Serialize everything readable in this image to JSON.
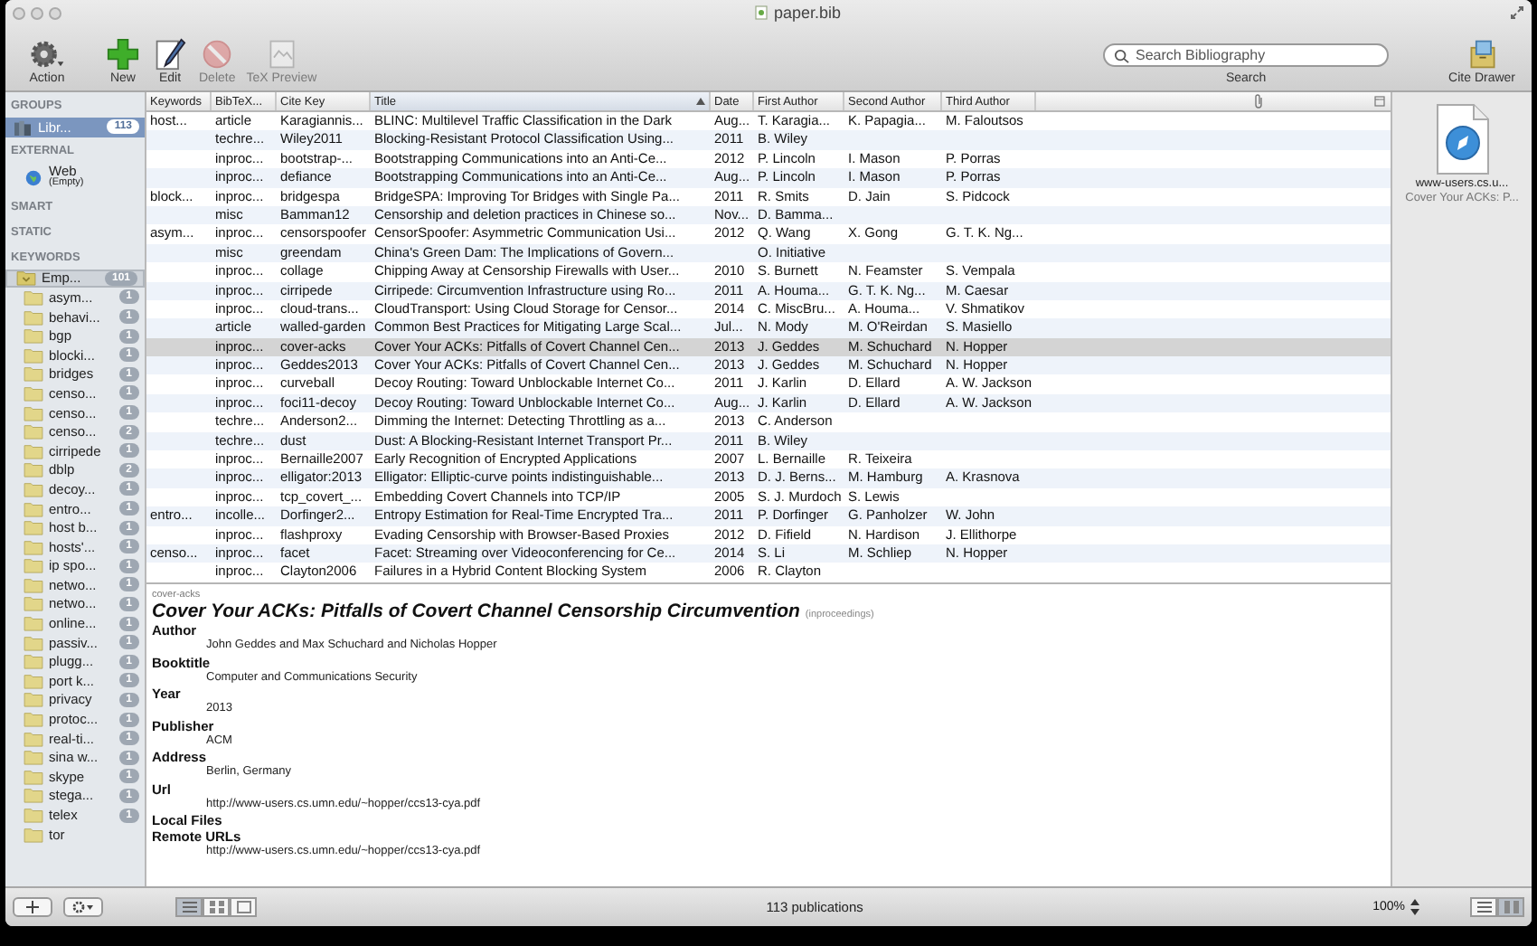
{
  "window": {
    "title": "paper.bib"
  },
  "toolbar": {
    "items": [
      {
        "kind": "action",
        "label": "Action",
        "disabled": false
      },
      {
        "kind": "new",
        "label": "New",
        "disabled": false
      },
      {
        "kind": "edit",
        "label": "Edit",
        "disabled": false
      },
      {
        "kind": "delete",
        "label": "Delete",
        "disabled": true
      },
      {
        "kind": "tex_preview",
        "label": "TeX Preview",
        "disabled": true
      }
    ],
    "search": {
      "placeholder": "Search Bibliography",
      "label": "Search"
    },
    "cite_drawer": {
      "label": "Cite Drawer"
    }
  },
  "sidebar": {
    "sections": [
      {
        "heading": "GROUPS",
        "items": [
          {
            "kind": "library",
            "label": "Libr...",
            "count": "113",
            "selected": true
          }
        ]
      },
      {
        "heading": "EXTERNAL",
        "items": [
          {
            "kind": "web",
            "label": "Web",
            "sublabel": "(Empty)",
            "selected": false
          }
        ]
      },
      {
        "heading": "SMART"
      },
      {
        "heading": "STATIC"
      },
      {
        "heading": "KEYWORDS",
        "items": [
          {
            "kind": "empty",
            "label": "Emp...",
            "count": "101",
            "selected": true
          },
          {
            "kind": "keyword",
            "label": "asym...",
            "count": "1",
            "selected": false
          },
          {
            "kind": "keyword",
            "label": "behavi...",
            "count": "1",
            "selected": false
          },
          {
            "kind": "keyword",
            "label": "bgp",
            "count": "1",
            "selected": false
          },
          {
            "kind": "keyword",
            "label": "blocki...",
            "count": "1",
            "selected": false
          },
          {
            "kind": "keyword",
            "label": "bridges",
            "count": "1",
            "selected": false
          },
          {
            "kind": "keyword",
            "label": "censo...",
            "count": "1",
            "selected": false
          },
          {
            "kind": "keyword",
            "label": "censo...",
            "count": "1",
            "selected": false
          },
          {
            "kind": "keyword",
            "label": "censo...",
            "count": "2",
            "selected": false
          },
          {
            "kind": "keyword",
            "label": "cirripede",
            "count": "1",
            "selected": false
          },
          {
            "kind": "keyword",
            "label": "dblp",
            "count": "2",
            "selected": false
          },
          {
            "kind": "keyword",
            "label": "decoy...",
            "count": "1",
            "selected": false
          },
          {
            "kind": "keyword",
            "label": "entro...",
            "count": "1",
            "selected": false
          },
          {
            "kind": "keyword",
            "label": "host b...",
            "count": "1",
            "selected": false
          },
          {
            "kind": "keyword",
            "label": "hosts'...",
            "count": "1",
            "selected": false
          },
          {
            "kind": "keyword",
            "label": "ip spo...",
            "count": "1",
            "selected": false
          },
          {
            "kind": "keyword",
            "label": "netwo...",
            "count": "1",
            "selected": false
          },
          {
            "kind": "keyword",
            "label": "netwo...",
            "count": "1",
            "selected": false
          },
          {
            "kind": "keyword",
            "label": "online...",
            "count": "1",
            "selected": false
          },
          {
            "kind": "keyword",
            "label": "passiv...",
            "count": "1",
            "selected": false
          },
          {
            "kind": "keyword",
            "label": "plugg...",
            "count": "1",
            "selected": false
          },
          {
            "kind": "keyword",
            "label": "port k...",
            "count": "1",
            "selected": false
          },
          {
            "kind": "keyword",
            "label": "privacy",
            "count": "1",
            "selected": false
          },
          {
            "kind": "keyword",
            "label": "protoc...",
            "count": "1",
            "selected": false
          },
          {
            "kind": "keyword",
            "label": "real-ti...",
            "count": "1",
            "selected": false
          },
          {
            "kind": "keyword",
            "label": "sina w...",
            "count": "1",
            "selected": false
          },
          {
            "kind": "keyword",
            "label": "skype",
            "count": "1",
            "selected": false
          },
          {
            "kind": "keyword",
            "label": "stega...",
            "count": "1",
            "selected": false
          },
          {
            "kind": "keyword",
            "label": "telex",
            "count": "1",
            "selected": false
          },
          {
            "kind": "keyword",
            "label": "tor",
            "selected": false
          }
        ]
      }
    ]
  },
  "table": {
    "columns": [
      {
        "label": "Keywords",
        "sorted": false
      },
      {
        "label": "BibTeX...",
        "sorted": false
      },
      {
        "label": "Cite Key",
        "sorted": false
      },
      {
        "label": "Title",
        "sorted": true
      },
      {
        "label": "Date",
        "sorted": false
      },
      {
        "label": "First Author",
        "sorted": false
      },
      {
        "label": "Second Author",
        "sorted": false
      },
      {
        "label": "Third Author",
        "sorted": false
      }
    ],
    "rows": [
      {
        "selected": false,
        "keywords": "host...",
        "type": "article",
        "cite_key": "Karagiannis...",
        "title": "BLINC: Multilevel Traffic Classification in the Dark",
        "date": "Aug...",
        "first_author": "T. Karagia...",
        "second_author": "K. Papagia...",
        "third_author": "M. Faloutsos"
      },
      {
        "selected": false,
        "type": "techre...",
        "cite_key": "Wiley2011",
        "title": "Blocking-Resistant Protocol Classification Using...",
        "date": "2011",
        "first_author": "B. Wiley"
      },
      {
        "selected": false,
        "type": "inproc...",
        "cite_key": "bootstrap-...",
        "title": "Bootstrapping Communications into an Anti-Ce...",
        "date": "2012",
        "first_author": "P. Lincoln",
        "second_author": "I. Mason",
        "third_author": "P. Porras"
      },
      {
        "selected": false,
        "type": "inproc...",
        "cite_key": "defiance",
        "title": "Bootstrapping Communications into an Anti-Ce...",
        "date": "Aug...",
        "first_author": "P. Lincoln",
        "second_author": "I. Mason",
        "third_author": "P. Porras"
      },
      {
        "selected": false,
        "keywords": "block...",
        "type": "inproc...",
        "cite_key": "bridgespa",
        "title": "BridgeSPA: Improving Tor Bridges with Single Pa...",
        "date": "2011",
        "first_author": "R. Smits",
        "second_author": "D. Jain",
        "third_author": "S. Pidcock"
      },
      {
        "selected": false,
        "type": "misc",
        "cite_key": "Bamman12",
        "title": "Censorship and deletion practices in Chinese so...",
        "date": "Nov...",
        "first_author": "D. Bamma..."
      },
      {
        "selected": false,
        "keywords": "asym...",
        "type": "inproc...",
        "cite_key": "censorspoofer",
        "title": "CensorSpoofer: Asymmetric Communication Usi...",
        "date": "2012",
        "first_author": "Q. Wang",
        "second_author": "X. Gong",
        "third_author": "G. T. K. Ng..."
      },
      {
        "selected": false,
        "type": "misc",
        "cite_key": "greendam",
        "title": "China's Green Dam: The Implications of Govern...",
        "first_author": "O. Initiative"
      },
      {
        "selected": false,
        "type": "inproc...",
        "cite_key": "collage",
        "title": "Chipping Away at Censorship Firewalls with User...",
        "date": "2010",
        "first_author": "S. Burnett",
        "second_author": "N. Feamster",
        "third_author": "S. Vempala"
      },
      {
        "selected": false,
        "type": "inproc...",
        "cite_key": "cirripede",
        "title": "Cirripede: Circumvention Infrastructure using Ro...",
        "date": "2011",
        "first_author": "A. Houma...",
        "second_author": "G. T. K. Ng...",
        "third_author": "M. Caesar"
      },
      {
        "selected": false,
        "type": "inproc...",
        "cite_key": "cloud-trans...",
        "title": "CloudTransport: Using Cloud Storage for Censor...",
        "date": "2014",
        "first_author": "C. MiscBru...",
        "second_author": "A. Houma...",
        "third_author": "V. Shmatikov"
      },
      {
        "selected": false,
        "type": "article",
        "cite_key": "walled-garden",
        "title": "Common Best Practices for Mitigating Large Scal...",
        "date": "Jul...",
        "first_author": "N. Mody",
        "second_author": "M. O'Reirdan",
        "third_author": "S. Masiello"
      },
      {
        "selected": true,
        "type": "inproc...",
        "cite_key": "cover-acks",
        "title": "Cover Your ACKs: Pitfalls of Covert Channel Cen...",
        "date": "2013",
        "first_author": "J. Geddes",
        "second_author": "M. Schuchard",
        "third_author": "N. Hopper"
      },
      {
        "selected": false,
        "type": "inproc...",
        "cite_key": "Geddes2013",
        "title": "Cover Your ACKs: Pitfalls of Covert Channel Cen...",
        "date": "2013",
        "first_author": "J. Geddes",
        "second_author": "M. Schuchard",
        "third_author": "N. Hopper"
      },
      {
        "selected": false,
        "type": "inproc...",
        "cite_key": "curveball",
        "title": "Decoy Routing: Toward Unblockable Internet Co...",
        "date": "2011",
        "first_author": "J. Karlin",
        "second_author": "D. Ellard",
        "third_author": "A. W. Jackson"
      },
      {
        "selected": false,
        "type": "inproc...",
        "cite_key": "foci11-decoy",
        "title": "Decoy Routing: Toward Unblockable Internet Co...",
        "date": "Aug...",
        "first_author": "J. Karlin",
        "second_author": "D. Ellard",
        "third_author": "A. W. Jackson"
      },
      {
        "selected": false,
        "type": "techre...",
        "cite_key": "Anderson2...",
        "title": "Dimming the Internet: Detecting Throttling as a...",
        "date": "2013",
        "first_author": "C. Anderson"
      },
      {
        "selected": false,
        "type": "techre...",
        "cite_key": "dust",
        "title": "Dust: A Blocking-Resistant Internet Transport Pr...",
        "date": "2011",
        "first_author": "B. Wiley"
      },
      {
        "selected": false,
        "type": "inproc...",
        "cite_key": "Bernaille2007",
        "title": "Early Recognition of Encrypted Applications",
        "date": "2007",
        "first_author": "L. Bernaille",
        "second_author": "R. Teixeira"
      },
      {
        "selected": false,
        "type": "inproc...",
        "cite_key": "elligator:2013",
        "title": "Elligator: Elliptic-curve points indistinguishable...",
        "date": "2013",
        "first_author": "D. J. Berns...",
        "second_author": "M. Hamburg",
        "third_author": "A. Krasnova"
      },
      {
        "selected": false,
        "type": "inproc...",
        "cite_key": "tcp_covert_...",
        "title": "Embedding Covert Channels into TCP/IP",
        "date": "2005",
        "first_author": "S. J. Murdoch",
        "second_author": "S. Lewis"
      },
      {
        "selected": false,
        "keywords": "entro...",
        "type": "incolle...",
        "cite_key": "Dorfinger2...",
        "title": "Entropy Estimation for Real-Time Encrypted Tra...",
        "date": "2011",
        "first_author": "P. Dorfinger",
        "second_author": "G. Panholzer",
        "third_author": "W. John"
      },
      {
        "selected": false,
        "type": "inproc...",
        "cite_key": "flashproxy",
        "title": "Evading Censorship with Browser-Based Proxies",
        "date": "2012",
        "first_author": "D. Fifield",
        "second_author": "N. Hardison",
        "third_author": "J. Ellithorpe"
      },
      {
        "selected": false,
        "keywords": "censo...",
        "type": "inproc...",
        "cite_key": "facet",
        "title": "Facet: Streaming over Videoconferencing for Ce...",
        "date": "2014",
        "first_author": "S. Li",
        "second_author": "M. Schliep",
        "third_author": "N. Hopper"
      },
      {
        "selected": false,
        "type": "inproc...",
        "cite_key": "Clayton2006",
        "title": "Failures in a Hybrid Content Blocking System",
        "date": "2006",
        "first_author": "R. Clayton"
      }
    ]
  },
  "detail": {
    "cite_key": "cover-acks",
    "title": "Cover Your ACKs: Pitfalls of Covert Channel Censorship Circumvention",
    "type": "(inproceedings)",
    "fields": [
      {
        "name": "Author",
        "value": "John Geddes and Max Schuchard and Nicholas Hopper"
      },
      {
        "name": "Booktitle",
        "value": "Computer and Communications Security"
      },
      {
        "name": "Year",
        "value": "2013"
      },
      {
        "name": "Publisher",
        "value": "ACM"
      },
      {
        "name": "Address",
        "value": "Berlin, Germany"
      },
      {
        "name": "Url",
        "value": "http://www-users.cs.umn.edu/~hopper/ccs13-cya.pdf"
      },
      {
        "name": "Local Files"
      },
      {
        "name": "Remote URLs",
        "value": "http://www-users.cs.umn.edu/~hopper/ccs13-cya.pdf"
      }
    ]
  },
  "drawer": {
    "files": [
      {
        "name": "www-users.cs.u...",
        "title": "Cover Your ACKs: P..."
      }
    ]
  },
  "status_bar": {
    "count": "113 publications",
    "zoom": "100%"
  }
}
